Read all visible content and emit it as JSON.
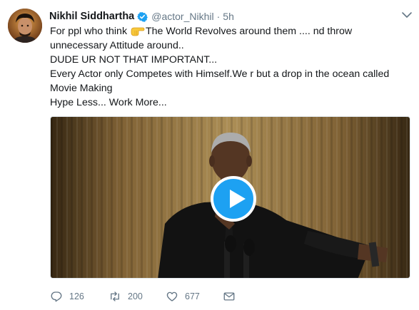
{
  "tweet": {
    "author_name": "Nikhil Siddhartha",
    "handle": "@actor_Nikhil",
    "separator": "·",
    "time": "5h",
    "line1_before": "For ppl who think ",
    "line1_after": "The World Revolves around them .... nd throw unnecessary Attitude around..",
    "line2": "DUDE UR NOT THAT IMPORTANT...",
    "line3": "Every Actor only Competes with Himself.We r but a drop in the ocean called Movie Making",
    "line4": "Hype Less... Work More..."
  },
  "icons": {
    "verified": "verified-badge-icon",
    "caret": "chevron-down-icon",
    "pointing_hand": "pointing-hand-emoji",
    "play": "play-icon",
    "reply": "reply-icon",
    "retweet": "retweet-icon",
    "like": "heart-icon",
    "message": "envelope-icon"
  },
  "actions": {
    "reply_count": "126",
    "retweet_count": "200",
    "like_count": "677"
  },
  "colors": {
    "accent": "#1da1f2",
    "muted": "#657786",
    "text": "#14171a"
  }
}
